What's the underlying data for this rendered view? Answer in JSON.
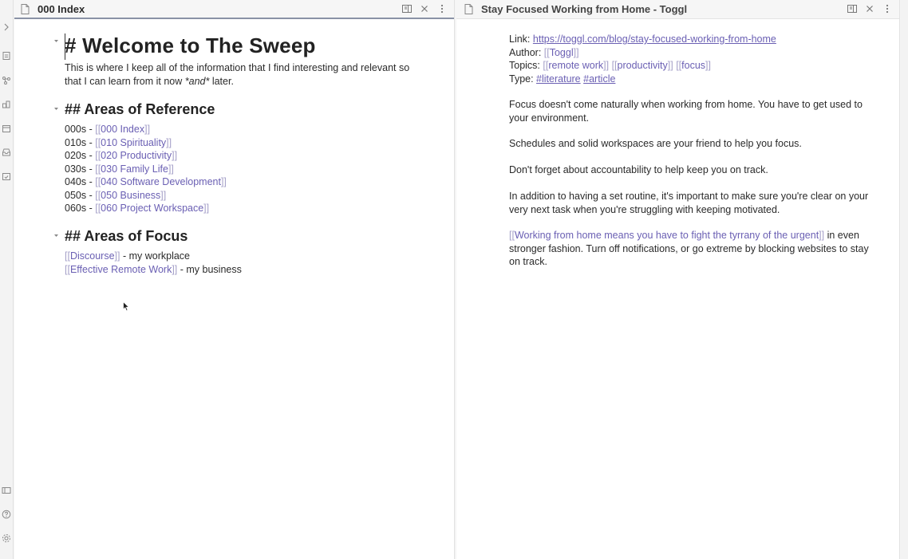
{
  "left_tab": {
    "title": "000 Index",
    "h1": "# Welcome to The Sweep",
    "intro_line1": "This is where I keep all of the information that I find interesting and relevant so",
    "intro_line2_a": "that I can learn from it now ",
    "intro_line2_em": "*and*",
    "intro_line2_b": " later.",
    "h2_reference": "## Areas of Reference",
    "reference_items": [
      {
        "prefix": "000s - ",
        "link": "000 Index"
      },
      {
        "prefix": "010s - ",
        "link": "010 Spirituality"
      },
      {
        "prefix": "020s - ",
        "link": "020 Productivity"
      },
      {
        "prefix": "030s - ",
        "link": "030 Family Life"
      },
      {
        "prefix": "040s - ",
        "link": "040 Software Development"
      },
      {
        "prefix": "050s - ",
        "link": "050 Business"
      },
      {
        "prefix": "060s - ",
        "link": "060 Project Workspace"
      }
    ],
    "h2_focus": "## Areas of Focus",
    "focus_items": [
      {
        "link": "Discourse",
        "suffix": " - my workplace"
      },
      {
        "link": "Effective Remote Work",
        "suffix": " - my business"
      }
    ]
  },
  "right_tab": {
    "title": "Stay Focused Working from Home - Toggl",
    "link_label": "Link: ",
    "link_url": "https://toggl.com/blog/stay-focused-working-from-home",
    "author_label": "Author: ",
    "author_link": "Toggl",
    "topics_label": "Topics: ",
    "topics": [
      "remote work",
      "productivity",
      "focus"
    ],
    "type_label": "Type: ",
    "type_tags": [
      "#literature",
      "#article"
    ],
    "p1_line1": "Focus doesn't come naturally when working from home. You have to get used to",
    "p1_line2": "your environment.",
    "p2": "Schedules and solid workspaces are your friend to help you focus.",
    "p3": "Don't forget about accountability to help keep you on track.",
    "p4_line1": "In addition to having a set routine, it's important to make sure you're clear on your",
    "p4_line2": "very next task when you're struggling with keeping motivated.",
    "p5_link": "Working from home means you have to fight the tyrrany of the urgent",
    "p5_line1_rest": " in even",
    "p5_line2": "stronger fashion. Turn off notifications, or go extreme by blocking websites to stay",
    "p5_line3": "on track."
  },
  "brackets": {
    "open": "[[",
    "close": "]]"
  },
  "colors": {
    "link": "#6a5fb3",
    "bracket": "#a5a0c8",
    "active_tab_border": "#8a92a6"
  },
  "icons": {
    "ribbon": [
      "chevron-right-icon",
      "file-icon",
      "graph-icon",
      "blocks-icon",
      "calendar-icon",
      "inbox-icon",
      "calendar-check-icon",
      "vault-icon",
      "help-icon",
      "settings-icon"
    ],
    "tab": [
      "file-icon",
      "reading-view-icon",
      "close-icon",
      "more-options-icon"
    ]
  }
}
